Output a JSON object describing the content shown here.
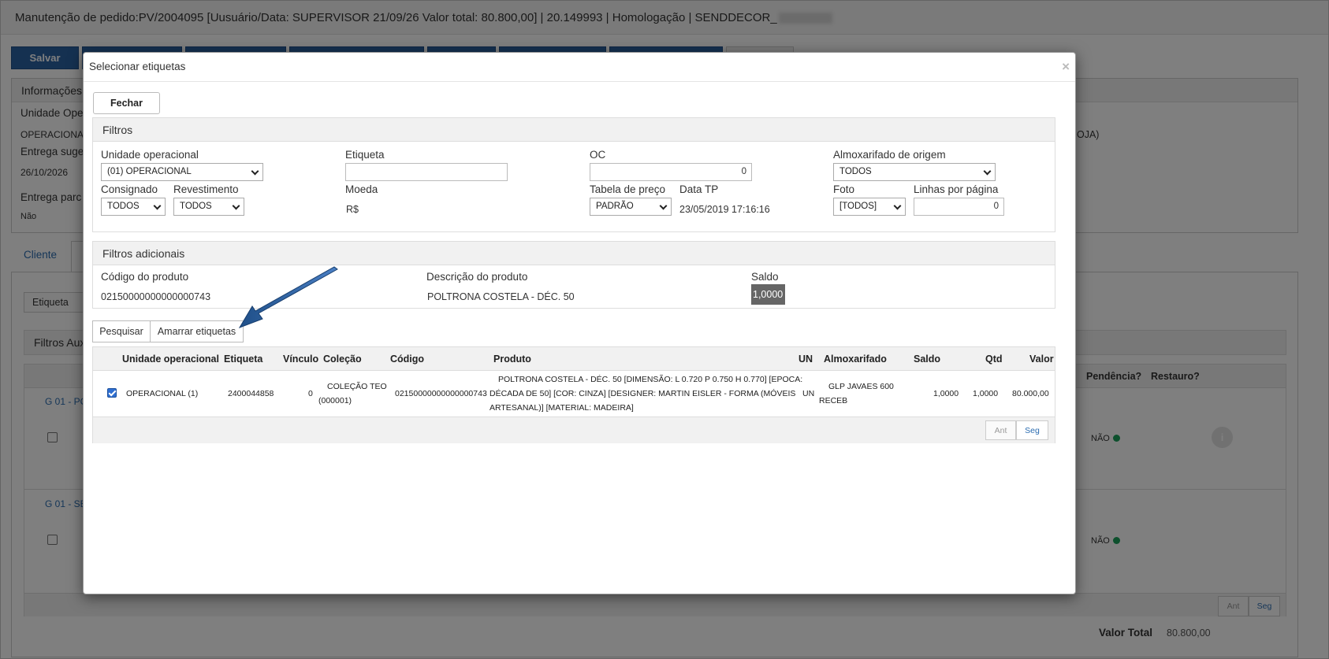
{
  "page": {
    "title": "Manutenção de pedido:PV/2004095 [Uusuário/Data: SUPERVISOR 21/09/26 Valor total: 80.800,00] | 20.149993 | Homologação | SENDDECOR_",
    "save_label": "Salvar",
    "info_title": "Informações",
    "unidade_label": "Unidade Ope",
    "unidade_value": "OPERACIONAL",
    "entrega_sug_label": "Entrega suge",
    "entrega_sug_value": "26/10/2026",
    "entrega_parc_label": "Entrega parc",
    "entrega_parc_value": "Não",
    "right_text": "OJA)",
    "tab_cliente": "Cliente",
    "etiqueta_btn": "Etiqueta",
    "filtros_aux": "Filtros Aux",
    "grid_head_pendencia": "Pendência?",
    "grid_head_restauro": "Restauro?",
    "row1_link": "G 01 - PC",
    "row1_nao": "NÃO",
    "row2_link": "G 01 - SE",
    "row2_nao": "NÃO",
    "pager_prev": "Ant",
    "pager_next": "Seg",
    "valor_total_label": "Valor Total",
    "valor_total": "80.800,00"
  },
  "modal": {
    "title": "Selecionar etiquetas",
    "close_icon": "×",
    "fechar": "Fechar",
    "filtros": {
      "title": "Filtros",
      "unidade_label": "Unidade operacional",
      "unidade_value": "(01) OPERACIONAL",
      "etiqueta_label": "Etiqueta",
      "etiqueta_value": "",
      "oc_label": "OC",
      "oc_value": "0",
      "almox_label": "Almoxarifado de origem",
      "almox_value": "TODOS",
      "consignado_label": "Consignado",
      "consignado_value": "TODOS",
      "revestimento_label": "Revestimento",
      "revestimento_value": "TODOS",
      "moeda_label": "Moeda",
      "moeda_value": "R$",
      "tabela_label": "Tabela de preço",
      "tabela_value": "PADRÃO",
      "data_tp_label": "Data TP",
      "data_tp_value": "23/05/2019 17:16:16",
      "foto_label": "Foto",
      "foto_value": "[TODOS]",
      "linhas_label": "Linhas por página",
      "linhas_value": "0"
    },
    "filtros_adicionais": {
      "title": "Filtros adicionais",
      "codigo_label": "Código do produto",
      "codigo_value": "02150000000000000743",
      "descricao_label": "Descrição do produto",
      "descricao_value": "POLTRONA COSTELA - DÉC. 50",
      "saldo_label": "Saldo",
      "saldo_value": "1,0000"
    },
    "actions": {
      "pesquisar": "Pesquisar",
      "amarrar": "Amarrar etiquetas"
    },
    "grid": {
      "headers": {
        "unidade": "Unidade operacional",
        "etiqueta": "Etiqueta",
        "vinculo": "Vínculo",
        "colecao": "Coleção",
        "codigo": "Código",
        "produto": "Produto",
        "un": "UN",
        "almox": "Almoxarifado",
        "saldo": "Saldo",
        "qtd": "Qtd",
        "valor": "Valor"
      },
      "row": {
        "checked": true,
        "unidade": "OPERACIONAL (1)",
        "etiqueta": "2400044858",
        "vinculo": "0",
        "colecao_1": "COLEÇÃO TEO",
        "colecao_2": "(000001)",
        "codigo": "02150000000000000743",
        "produto_1": "POLTRONA COSTELA - DÉC. 50 [DIMENSÃO: L 0.720 P 0.750 H 0.770] [EPOCA:",
        "produto_2": "DÉCADA DE 50] [COR: CINZA] [DESIGNER: MARTIN EISLER - FORMA (MÓVEIS",
        "produto_3": "ARTESANAL)] [MATERIAL: MADEIRA]",
        "un": "UN",
        "almox_1": "GLP JAVAES 600",
        "almox_2": "RECEB",
        "saldo": "1,0000",
        "qtd": "1,0000",
        "valor": "80.000,00"
      },
      "pager_prev": "Ant",
      "pager_next": "Seg"
    }
  },
  "colors": {
    "primary": "#2b62a3",
    "link": "#2b6cb0",
    "arrow": "#1f4f88",
    "status_ok": "#1aa05a"
  }
}
